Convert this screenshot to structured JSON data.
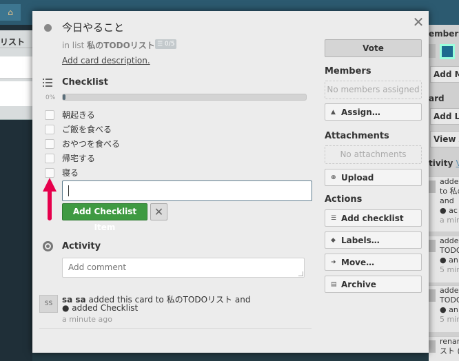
{
  "background": {
    "home_icon": "home-icon",
    "left_list_title": "リスト",
    "right_panel": {
      "members_label": "embers",
      "add_members": "Add Me",
      "board_label": "ard",
      "add_list": "Add Lis",
      "view_all": "View A",
      "activity_label": "tivity",
      "activity_view": "Vi",
      "entries": [
        {
          "l1": "added",
          "l2": "to 私の",
          "l3": "and",
          "l4": "● ac",
          "time": "a min"
        },
        {
          "l1": "adde",
          "l2": "TODO",
          "l3": "● an",
          "time": "5 min"
        },
        {
          "l1": "adde",
          "l2": "TODO",
          "l3": "● an",
          "time": "5 min"
        },
        {
          "l1": "renar",
          "l2": "スト (W"
        }
      ]
    }
  },
  "modal": {
    "close_icon": "close-icon",
    "card_title": "今日やること",
    "in_list_prefix": "in list",
    "list_name": "私のTODOリスト",
    "checklist_badge": "☰ 0/5",
    "add_description": "Add card description.",
    "checklist": {
      "title": "Checklist",
      "percent_label": "0%",
      "progress_fraction": 0.01,
      "items": [
        "朝起きる",
        "ご飯を食べる",
        "おやつを食べる",
        "帰宅する",
        "寝る"
      ],
      "add_button": "Add Checklist Item",
      "cancel_icon": "close-icon"
    },
    "activity": {
      "title": "Activity",
      "comment_placeholder": "Add comment",
      "entry": {
        "avatar_initials": "SS",
        "user": "sa sa",
        "text": "added this card to 私のTODOリスト and",
        "bullet": "●  added Checklist",
        "time": "a minute ago"
      }
    },
    "sidebar": {
      "vote_label": "Vote",
      "members_title": "Members",
      "members_empty": "No members assigned",
      "assign_label": "Assign…",
      "attachments_title": "Attachments",
      "attachments_empty": "No attachments",
      "upload_label": "Upload",
      "actions_title": "Actions",
      "actions": [
        {
          "label": "Add checklist",
          "icon": "checklist-icon"
        },
        {
          "label": "Labels…",
          "icon": "tag-icon"
        },
        {
          "label": "Move…",
          "icon": "arrow-right-icon"
        },
        {
          "label": "Archive",
          "icon": "archive-icon"
        }
      ]
    }
  },
  "colors": {
    "add_button_green": "#3f9a42",
    "annotation_arrow_red": "#e6004c",
    "board_blue": "#2c5a70"
  }
}
